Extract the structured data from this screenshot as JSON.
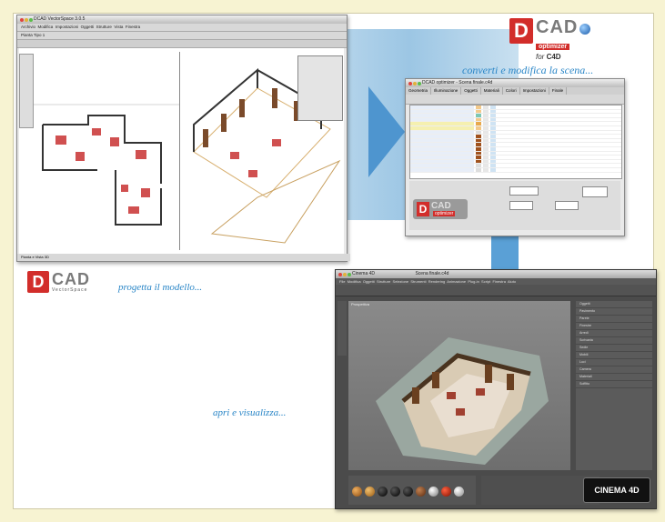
{
  "taglines": {
    "convert": "converti e modifica la scena...",
    "design": "progetta il modello...",
    "open": "apri e visualizza..."
  },
  "logos": {
    "dcad_top": {
      "d": "D",
      "cad": "CAD",
      "optimizer": "optimizer",
      "for": "for",
      "c4d": "C4D"
    },
    "dcad_mid": {
      "d": "D",
      "cad": "CAD",
      "vectorspace": "VectorSpace"
    },
    "cinema4d": "CINEMA 4D"
  },
  "dcad_window": {
    "title": "DCAD VectorSpace 3.0.5",
    "menu": [
      "Archivio",
      "Modifica",
      "Impostazioni",
      "Oggetti",
      "Strutture",
      "Vista",
      "Finestra"
    ],
    "toolbar_text": "Pianta Tipo 1",
    "status_text": "Pianta e Vista 3D"
  },
  "optimizer_window": {
    "title": "DCAD optimizer - Scena finale.c4d",
    "tabs": [
      "Geometria",
      "Illuminazione",
      "Oggetti",
      "Materiali",
      "Colori",
      "Impostazioni",
      "Finale"
    ]
  },
  "c4d_window": {
    "title": "Scena finale.c4d",
    "app": "Cinema 4D",
    "menu": [
      "File",
      "Modifica",
      "Oggetti",
      "Strutture",
      "Selezione",
      "Strumenti",
      "Rendering",
      "Animazione",
      "Plug-in",
      "Script",
      "Finestra",
      "Aiuto"
    ],
    "viewport_label": "Prospettiva",
    "objects": [
      "Oggetti",
      "Pavimento",
      "Parete",
      "Finestre",
      "Arredi",
      "Scrivania",
      "Sedie",
      "Mobili",
      "Luci",
      "Camera",
      "Materiali",
      "Soffitto"
    ]
  },
  "colors": {
    "accent_red": "#d22d2a",
    "tagline_blue": "#2a86c7",
    "panel_blue": "#5aa0d6"
  }
}
